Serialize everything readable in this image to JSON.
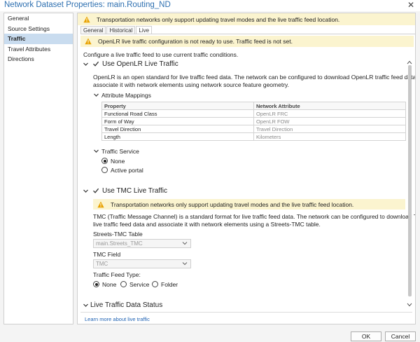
{
  "window": {
    "title": "Network Dataset Properties: main.Routing_ND",
    "close_glyph": "✕"
  },
  "sidebar": {
    "items": [
      {
        "label": "General"
      },
      {
        "label": "Source Settings"
      },
      {
        "label": "Traffic",
        "active": true
      },
      {
        "label": "Travel Attributes"
      },
      {
        "label": "Directions"
      }
    ]
  },
  "banner_top": {
    "text": "Transportation networks only support updating travel modes and the live traffic feed location."
  },
  "tabs": [
    {
      "label": "General"
    },
    {
      "label": "Historical"
    },
    {
      "label": "Live",
      "active": true
    }
  ],
  "banner_openlr": {
    "text": "OpenLR live traffic configuration is not ready to use. Traffic feed is not set."
  },
  "intro": {
    "text": "Configure a live traffic feed to use current traffic conditions."
  },
  "openlr": {
    "title": "Use OpenLR Live Traffic",
    "checked": true,
    "description_line1": "OpenLR is an open standard for live traffic feed data. The network can be configured to download OpenLR traffic feed data and",
    "description_line2": "associate it with network elements using network source feature geometry.",
    "attribute_mappings": {
      "title": "Attribute Mappings",
      "columns": [
        "Property",
        "Network Attribute"
      ],
      "rows": [
        [
          "Functional Road Class",
          "OpenLR FRC"
        ],
        [
          "Form of Way",
          "OpenLR FOW"
        ],
        [
          "Travel Direction",
          "Travel Direction"
        ],
        [
          "Length",
          "Kilometers"
        ]
      ]
    },
    "traffic_service": {
      "title": "Traffic Service",
      "options": [
        {
          "label": "None",
          "selected": true
        },
        {
          "label": "Active portal",
          "selected": false
        }
      ]
    }
  },
  "tmc": {
    "title": "Use TMC Live Traffic",
    "checked": true,
    "banner": "Transportation networks only support updating travel modes and the live traffic feed location.",
    "description_line1": "TMC (Traffic Message Channel) is a standard format for live traffic feed data. The network can be configured to download TMC",
    "description_line2": "live traffic feed data and associate it with network elements using a Streets-TMC table.",
    "table_label": "Streets-TMC Table",
    "table_value": "main.Streets_TMC",
    "field_label": "TMC Field",
    "field_value": "TMC",
    "feed_type_label": "Traffic Feed Type:",
    "feed_types": [
      {
        "label": "None",
        "selected": true
      },
      {
        "label": "Service",
        "selected": false
      },
      {
        "label": "Folder",
        "selected": false
      }
    ]
  },
  "status": {
    "title": "Live Traffic Data Status"
  },
  "help_link": "Learn more about live traffic",
  "buttons": {
    "ok": "OK",
    "cancel": "Cancel"
  },
  "colors": {
    "accent": "#2d6fb0",
    "warning_bg": "#fbf4cf",
    "warning_icon": "#e8a200",
    "selected_nav": "#c9dcef",
    "link": "#1f62b3"
  }
}
